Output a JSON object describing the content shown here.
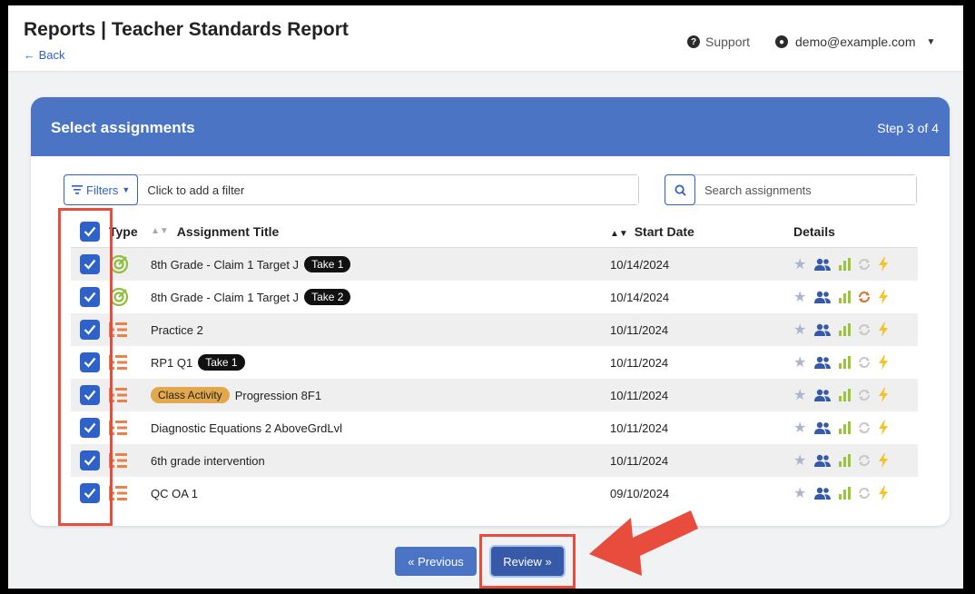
{
  "header": {
    "title": "Reports | Teacher Standards Report",
    "back_label": "← Back",
    "support_label": "Support",
    "user_email": "demo@example.com"
  },
  "card": {
    "title": "Select assignments",
    "step": "Step 3 of 4"
  },
  "filters": {
    "button_label": "Filters",
    "placeholder": "Click to add a filter"
  },
  "search": {
    "placeholder": "Search assignments"
  },
  "table": {
    "columns": {
      "type": "Type",
      "title": "Assignment Title",
      "start_date": "Start Date",
      "details": "Details"
    },
    "rows": [
      {
        "type": "target",
        "title": "8th Grade - Claim 1 Target J",
        "badge": "Take 1",
        "activity": "",
        "date": "10/14/2024",
        "sync_highlight": false
      },
      {
        "type": "target",
        "title": "8th Grade - Claim 1 Target J",
        "badge": "Take 2",
        "activity": "",
        "date": "10/14/2024",
        "sync_highlight": true
      },
      {
        "type": "list",
        "title": "Practice 2",
        "badge": "",
        "activity": "",
        "date": "10/11/2024",
        "sync_highlight": false
      },
      {
        "type": "list",
        "title": "RP1 Q1",
        "badge": "Take 1",
        "activity": "",
        "date": "10/11/2024",
        "sync_highlight": false
      },
      {
        "type": "list",
        "title": "Progression 8F1",
        "badge": "",
        "activity": "Class Activity",
        "date": "10/11/2024",
        "sync_highlight": false
      },
      {
        "type": "list",
        "title": "Diagnostic Equations 2 AboveGrdLvl",
        "badge": "",
        "activity": "",
        "date": "10/11/2024",
        "sync_highlight": false
      },
      {
        "type": "list",
        "title": "6th grade intervention",
        "badge": "",
        "activity": "",
        "date": "10/11/2024",
        "sync_highlight": false
      },
      {
        "type": "list",
        "title": "QC OA 1",
        "badge": "",
        "activity": "",
        "date": "09/10/2024",
        "sync_highlight": false
      }
    ]
  },
  "buttons": {
    "previous": "« Previous",
    "review": "Review »"
  },
  "colors": {
    "primary": "#4b75c4",
    "checkbox": "#2f62c9",
    "annotation": "#e74c3c"
  }
}
